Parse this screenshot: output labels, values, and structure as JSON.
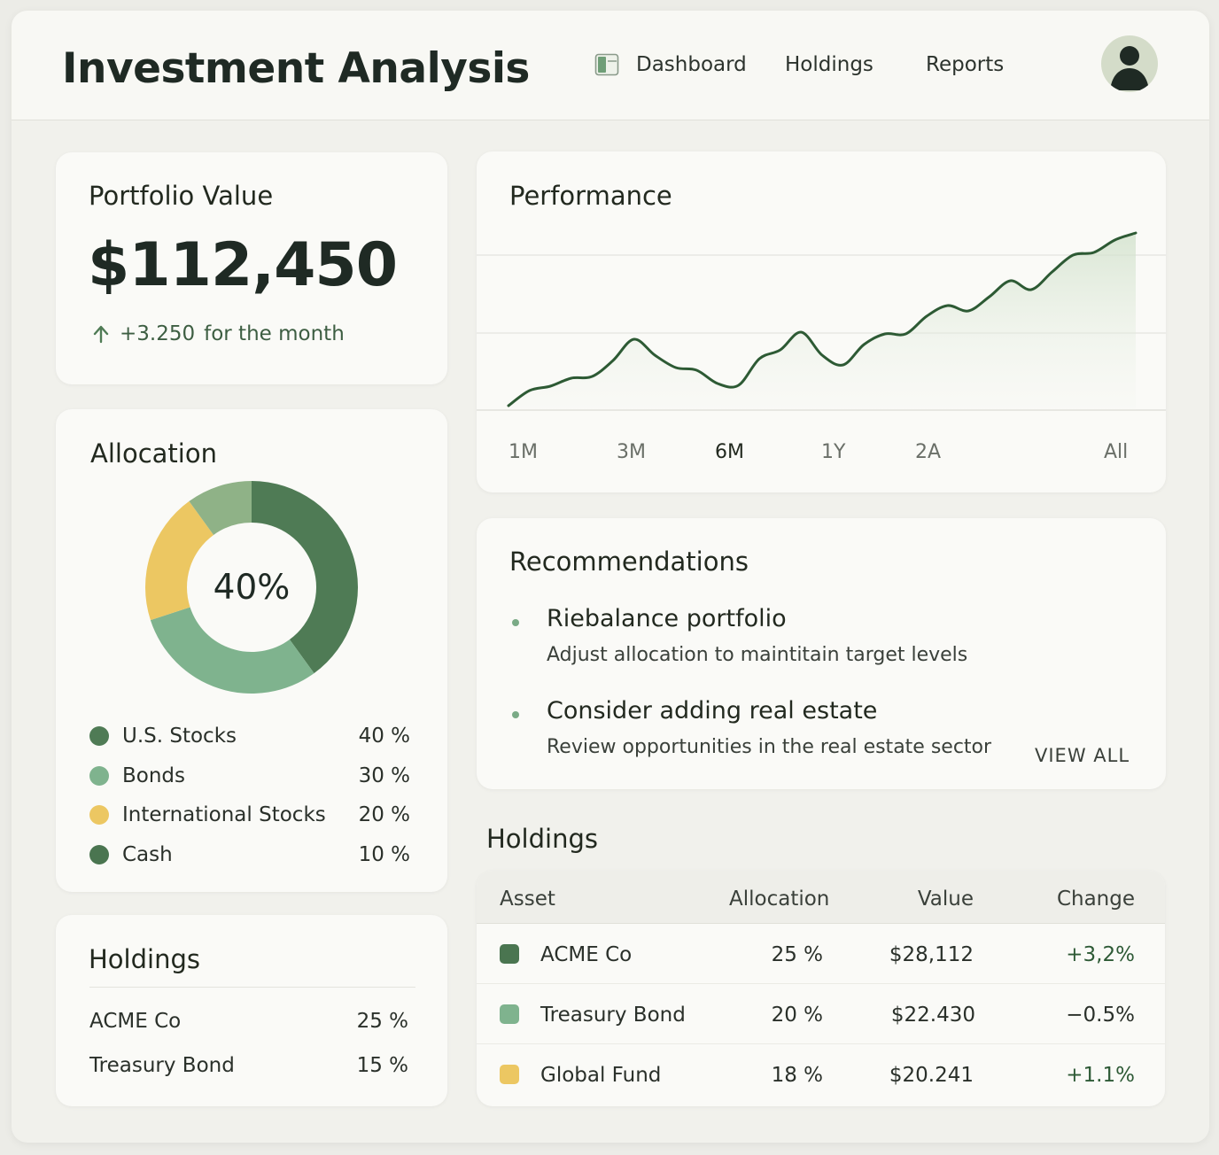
{
  "header": {
    "title": "Investment Analysis",
    "nav": [
      {
        "label": "Dashboard",
        "icon": "dashboard-icon"
      },
      {
        "label": "Holdings"
      },
      {
        "label": "Reports"
      }
    ],
    "avatar_icon": "user-avatar-icon"
  },
  "portfolio": {
    "title": "Portfolio Value",
    "value": "$112,450",
    "change_amount": "+3.250",
    "change_period": "for the month",
    "change_icon": "arrow-up-icon"
  },
  "allocation": {
    "title": "Allocation",
    "center_label": "40%",
    "items": [
      {
        "name": "U.S. Stocks",
        "pct": "40 %",
        "value": 40,
        "color": "#4f7b55"
      },
      {
        "name": "Bonds",
        "pct": "30 %",
        "value": 30,
        "color": "#7fb38e"
      },
      {
        "name": "International Stocks",
        "pct": "20 %",
        "value": 20,
        "color": "#ecc762"
      },
      {
        "name": "Cash",
        "pct": "10 %",
        "value": 10,
        "color": "#8fb287"
      }
    ],
    "legend_colors": [
      "#4f7b55",
      "#7fb38e",
      "#ecc762",
      "#4a7550"
    ]
  },
  "holdings_small": {
    "title": "Holdings",
    "rows": [
      {
        "name": "ACME Co",
        "pct": "25 %"
      },
      {
        "name": "Treasury Bond",
        "pct": "15 %"
      }
    ]
  },
  "performance": {
    "title": "Performance",
    "tabs": [
      "1M",
      "3M",
      "6M",
      "1Y",
      "2A",
      "All"
    ],
    "active_tab": "6M",
    "line_color": "#2d5a34"
  },
  "chart_data": {
    "type": "line",
    "title": "Performance",
    "x": [
      0,
      1,
      2,
      3,
      4,
      5,
      6,
      7,
      8,
      9,
      10,
      11,
      12,
      13,
      14,
      15,
      16,
      17,
      18,
      19,
      20,
      21,
      22,
      23,
      24,
      25,
      26,
      27,
      28,
      29,
      30
    ],
    "series": [
      {
        "values": [
          5,
          22,
          27,
          36,
          38,
          56,
          80,
          62,
          48,
          45,
          30,
          28,
          58,
          68,
          88,
          62,
          51,
          74,
          86,
          86,
          106,
          118,
          112,
          128,
          146,
          136,
          156,
          175,
          178,
          192,
          200
        ]
      }
    ],
    "grid": true,
    "ylim": [
      0,
      230
    ]
  },
  "recommendations": {
    "title": "Recommendations",
    "items": [
      {
        "title": "Riebalance portfolio",
        "subtitle": "Adjust allocation to maintitain target levels"
      },
      {
        "title": "Consider adding real estate",
        "subtitle": "Review opportunities in the real estate sector"
      }
    ],
    "view_all": "VIEW ALL"
  },
  "holdings": {
    "title": "Holdings",
    "columns": [
      "Asset",
      "Allocation",
      "Value",
      "Change"
    ],
    "rows": [
      {
        "asset": "ACME Co",
        "allocation": "25 %",
        "value": "$28,112",
        "change": "+3,2%",
        "color": "#4a7550",
        "direction": "up"
      },
      {
        "asset": "Treasury Bond",
        "allocation": "20 %",
        "value": "$22.430",
        "change": "−0.5%",
        "color": "#7fb38e",
        "direction": "down"
      },
      {
        "asset": "Global Fund",
        "allocation": "18 %",
        "value": "$20.241",
        "change": "+1.1%",
        "color": "#ecc762",
        "direction": "up"
      }
    ]
  }
}
